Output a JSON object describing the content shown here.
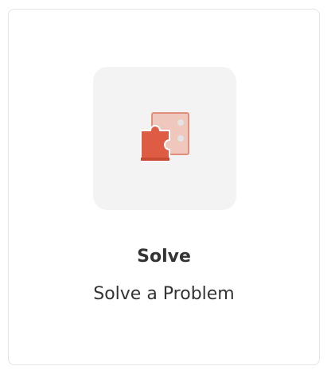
{
  "card": {
    "title": "Solve",
    "subtitle": "Solve a Problem",
    "icon": "puzzle-piece-icon"
  },
  "colors": {
    "accent": "#dd5c43",
    "accent_light": "#e9a291",
    "tile_background": "#f3f3f3",
    "text": "#333333",
    "border": "#e4e4e4"
  }
}
